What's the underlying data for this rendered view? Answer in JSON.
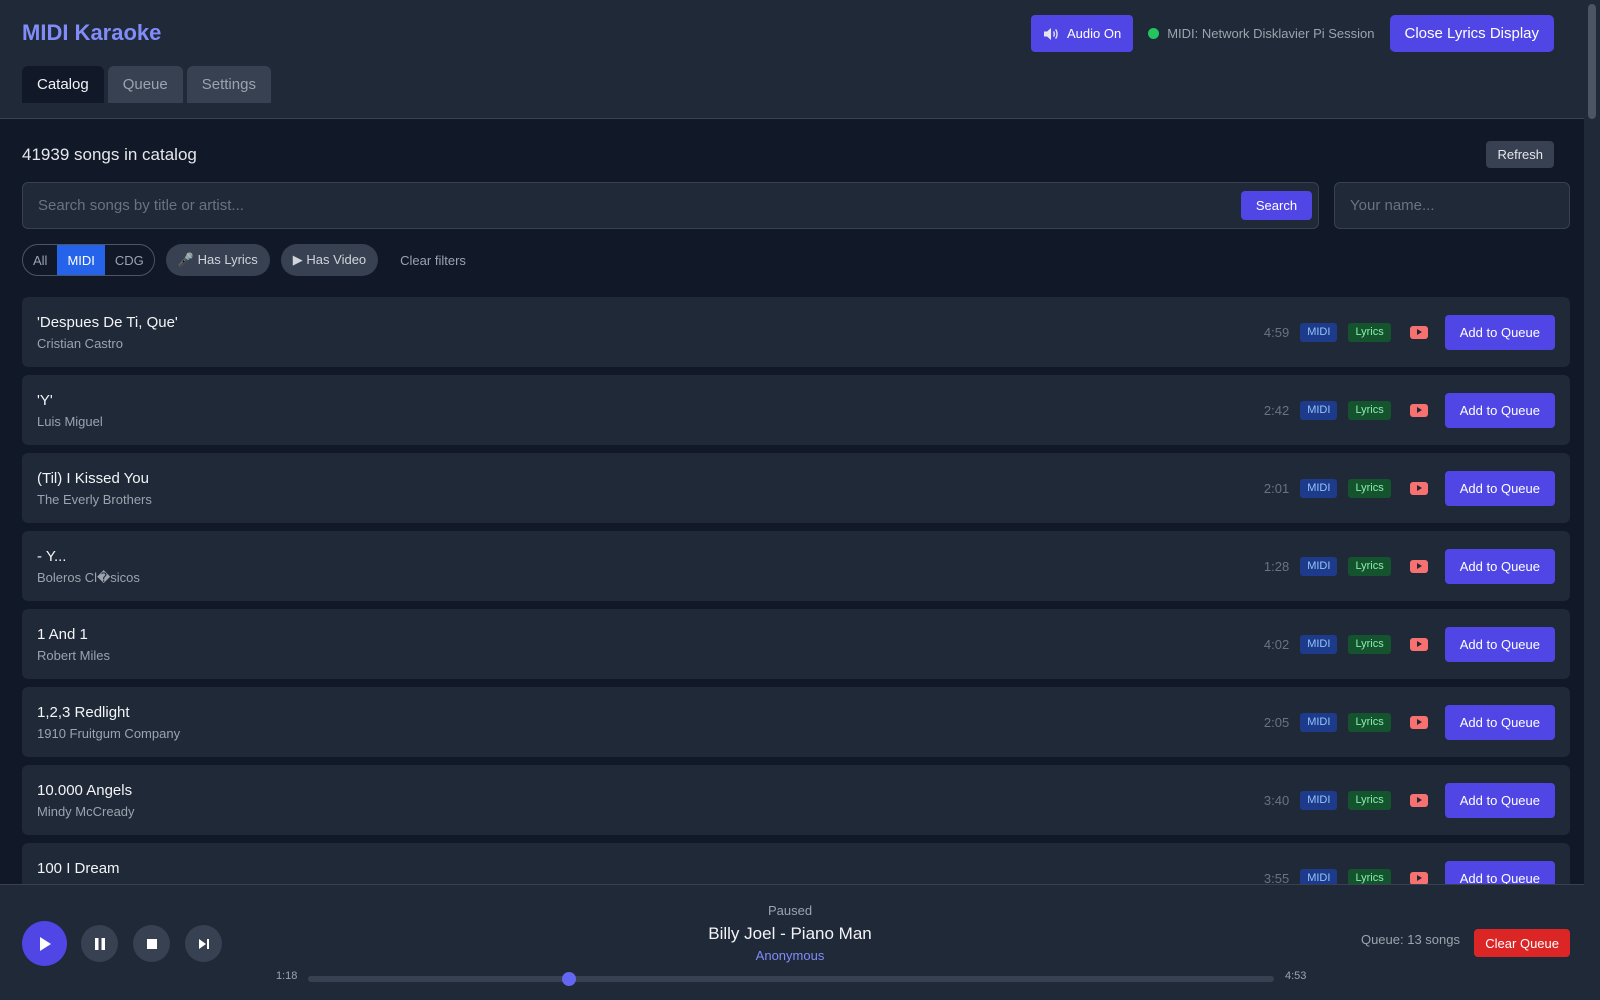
{
  "app": {
    "title": "MIDI Karaoke"
  },
  "tabs": [
    {
      "label": "Catalog",
      "active": true
    },
    {
      "label": "Queue",
      "active": false
    },
    {
      "label": "Settings",
      "active": false
    }
  ],
  "header": {
    "audio_label": "Audio On",
    "audio_icon": "speaker-icon",
    "midi_status": "MIDI: Network Disklavier Pi Session",
    "midi_status_color": "#22c55e",
    "close_lyrics_label": "Close Lyrics Display"
  },
  "catalog": {
    "count_text": "41939 songs in catalog",
    "refresh_label": "Refresh"
  },
  "search": {
    "placeholder": "Search songs by title or artist...",
    "value": "",
    "button_label": "Search",
    "name_placeholder": "Your name...",
    "name_value": ""
  },
  "filters": {
    "formats": [
      {
        "label": "All",
        "active": false
      },
      {
        "label": "MIDI",
        "active": true
      },
      {
        "label": "CDG",
        "active": false
      }
    ],
    "has_lyrics_label": "🎤 Has Lyrics",
    "has_video_label": "▶ Has Video",
    "clear_label": "Clear filters"
  },
  "song_labels": {
    "midi_badge": "MIDI",
    "lyrics_badge": "Lyrics",
    "add_button": "Add to Queue"
  },
  "songs": [
    {
      "title": "'Despues De Ti, Que'",
      "artist": "Cristian Castro",
      "duration": "4:59"
    },
    {
      "title": "'Y'",
      "artist": "Luis Miguel",
      "duration": "2:42"
    },
    {
      "title": "(Til) I Kissed You",
      "artist": "The Everly Brothers",
      "duration": "2:01"
    },
    {
      "title": "- Y...",
      "artist": "Boleros Cl�sicos",
      "duration": "1:28"
    },
    {
      "title": "1 And 1",
      "artist": "Robert Miles",
      "duration": "4:02"
    },
    {
      "title": "1,2,3 Redlight",
      "artist": "1910 Fruitgum Company",
      "duration": "2:05"
    },
    {
      "title": "10.000 Angels",
      "artist": "Mindy McCready",
      "duration": "3:40"
    },
    {
      "title": "100 I Dream",
      "artist": "",
      "duration": "3:55"
    }
  ],
  "player": {
    "status": "Paused",
    "now_playing": "Billy Joel - Piano Man",
    "singer": "Anonymous",
    "current_time": "1:18",
    "total_time": "4:53",
    "progress": 0.27,
    "queue_text": "Queue: 13 songs",
    "clear_queue_label": "Clear Queue",
    "accent_color": "#4f46e5"
  }
}
